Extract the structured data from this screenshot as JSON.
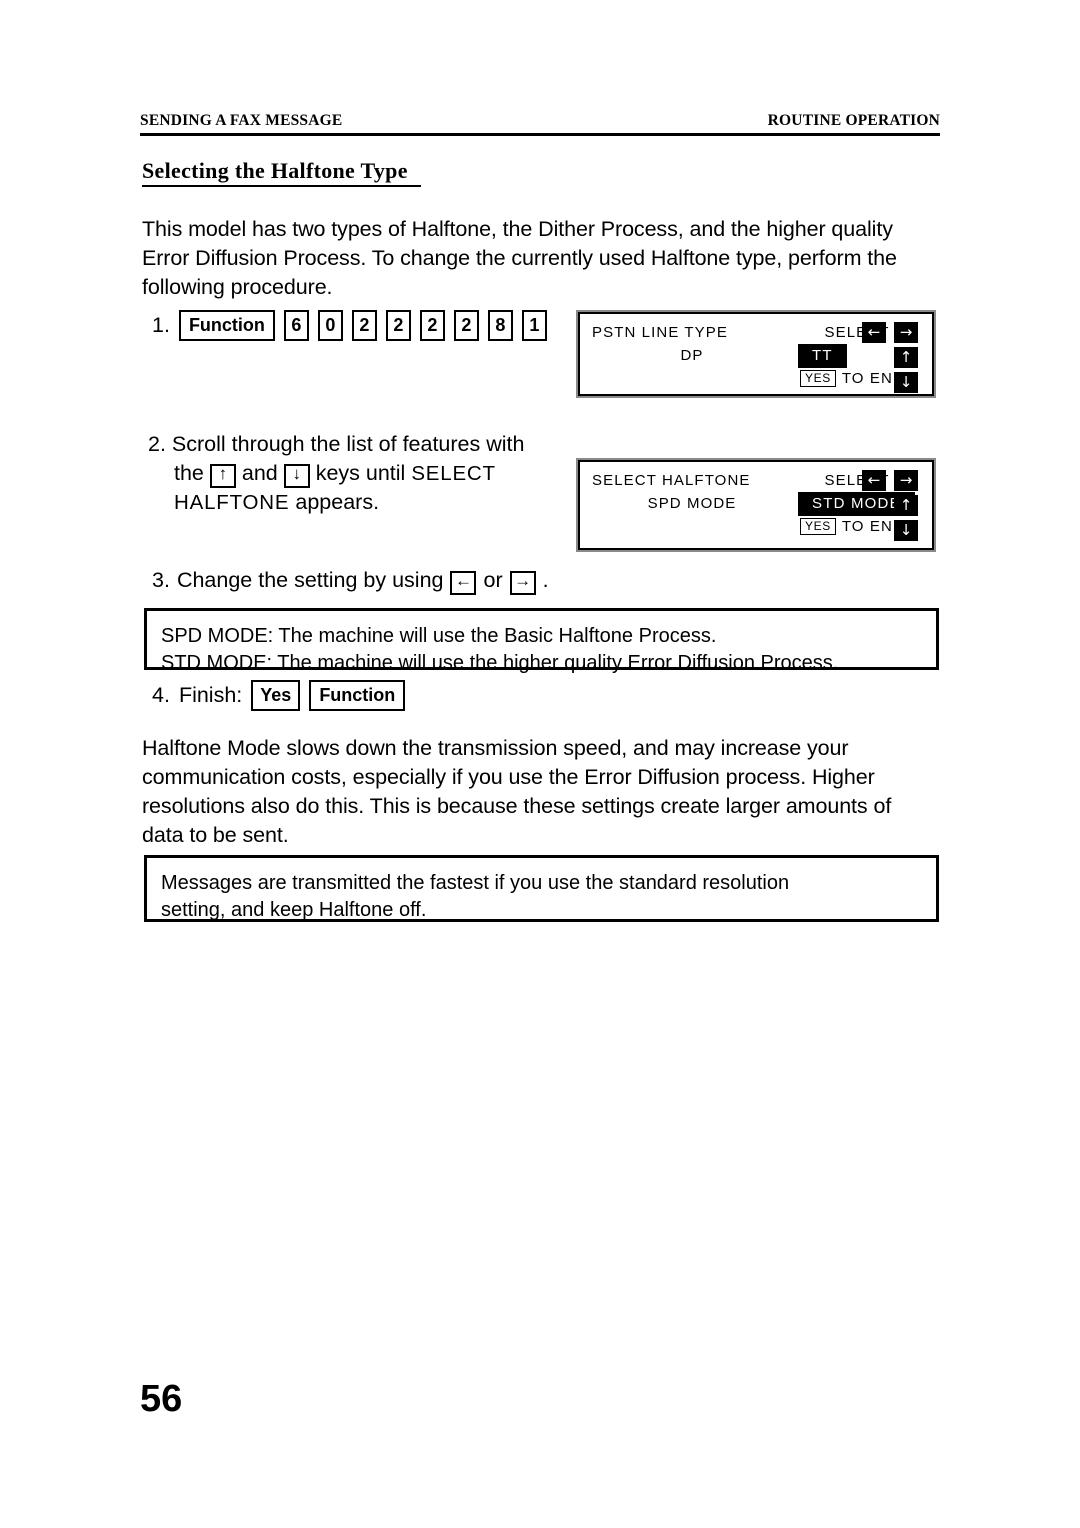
{
  "header": {
    "left": "SENDING A FAX MESSAGE",
    "right": "ROUTINE OPERATION"
  },
  "section": {
    "title": "Selecting the Halftone Type"
  },
  "intro_paragraph": "This model has two types of Halftone, the Dither Process, and the higher quality Error Diffusion Process. To change the currently used Halftone type, perform the following procedure.",
  "steps": {
    "step1": {
      "number": "1.",
      "keys": [
        {
          "label": "Function",
          "type": "wide"
        },
        {
          "label": "6",
          "type": "num"
        },
        {
          "label": "0",
          "type": "num"
        },
        {
          "label": "2",
          "type": "num"
        },
        {
          "label": "2",
          "type": "num"
        },
        {
          "label": "2",
          "type": "num"
        },
        {
          "label": "2",
          "type": "num"
        },
        {
          "label": "8",
          "type": "num"
        },
        {
          "label": "1",
          "type": "num"
        }
      ]
    },
    "step2": {
      "number": "2.",
      "text_a": "Scroll through the list of features with",
      "text_b": "the",
      "key_up": "↑",
      "text_c": "and",
      "key_down": "↓",
      "text_d": "keys until",
      "lcd_ref_a": "SELECT",
      "lcd_ref_b": "HALFTONE",
      "text_e": "appears."
    },
    "step3": {
      "number": "3.",
      "text_a": "Change the setting by using",
      "key_left": "←",
      "text_b": "or",
      "key_right": "→",
      "text_c": "."
    },
    "step4": {
      "number": "4.",
      "label": "Finish:",
      "key_yes": "Yes",
      "key_function": "Function"
    }
  },
  "lcd_panels": [
    {
      "title": "PSTN LINE TYPE",
      "select_label": "SELECT",
      "current_value": "DP",
      "highlighted_value": "TT",
      "end_key": "YES",
      "end_text": "TO END",
      "arrow_left": "←",
      "arrow_right": "→",
      "arrow_up": "↑",
      "arrow_down": "↓"
    },
    {
      "title": "SELECT HALFTONE",
      "select_label": "SELECT",
      "current_value": "SPD MODE",
      "highlighted_value": "STD MODE",
      "end_key": "YES",
      "end_text": "TO END",
      "arrow_left": "←",
      "arrow_right": "→",
      "arrow_up": "↑",
      "arrow_down": "↓"
    }
  ],
  "callout1": {
    "line1": "SPD MODE: The machine will use the Basic Halftone Process.",
    "line2": "STD MODE: The machine will use the higher quality Error Diffusion Process."
  },
  "note_paragraph": "Halftone Mode slows down the transmission speed, and may increase your communication costs, especially if you use the Error Diffusion process. Higher resolutions also do this. This is because these settings create larger amounts of data to be sent.",
  "callout2": {
    "line1": "Messages are transmitted the fastest if you use the standard resolution",
    "line2": "setting, and keep Halftone off."
  },
  "page_number": "56",
  "colors": {
    "ink": "#000000",
    "paper": "#ffffff",
    "panel_outline": "#8a8a8a"
  }
}
